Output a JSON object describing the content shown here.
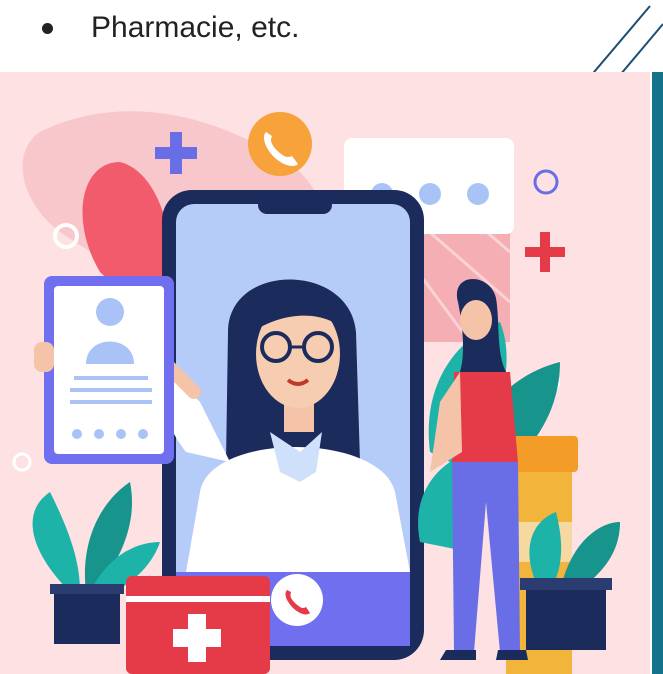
{
  "bullet": {
    "text": "Pharmacie, etc."
  },
  "colors": {
    "background": "#fde1e3",
    "accent_bar": "#14728a",
    "phone_frame": "#1b2b5c",
    "phone_screen": "#b6ccf8",
    "medical_red": "#e53a48",
    "call_orange": "#f7a23a",
    "plus_purple": "#6a6ee6"
  },
  "icons": {
    "phone_call": "phone-icon",
    "first_aid": "first-aid-kit-icon",
    "chat": "chat-bubble-icon",
    "profile": "profile-card-icon"
  }
}
